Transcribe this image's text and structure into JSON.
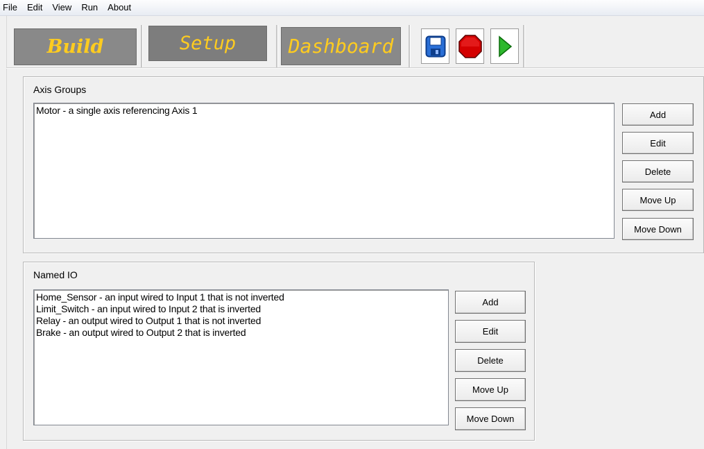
{
  "menu": [
    "File",
    "Edit",
    "View",
    "Run",
    "About"
  ],
  "nav": {
    "build": "Build",
    "setup": "Setup",
    "dashboard": "Dashboard"
  },
  "toolbar_icons": [
    "save-icon",
    "stop-icon",
    "play-icon"
  ],
  "colors": {
    "nav_text": "#ffcc1f",
    "nav_bg": "#898989",
    "stop": "#d40000",
    "play": "#2db82d",
    "save": "#2a6fd6"
  },
  "axis_groups": {
    "title": "Axis Groups",
    "items": [
      "Motor - a single axis referencing Axis 1"
    ],
    "buttons": {
      "add": "Add",
      "edit": "Edit",
      "delete": "Delete",
      "move_up": "Move Up",
      "move_down": "Move Down"
    }
  },
  "named_io": {
    "title": "Named IO",
    "items": [
      "Home_Sensor - an input wired to Input 1 that is not inverted",
      "Limit_Switch - an input wired to Input 2 that is inverted",
      "Relay - an output wired to Output 1 that is not inverted",
      "Brake - an output wired to Output 2 that is inverted"
    ],
    "buttons": {
      "add": "Add",
      "edit": "Edit",
      "delete": "Delete",
      "move_up": "Move Up",
      "move_down": "Move Down"
    }
  }
}
